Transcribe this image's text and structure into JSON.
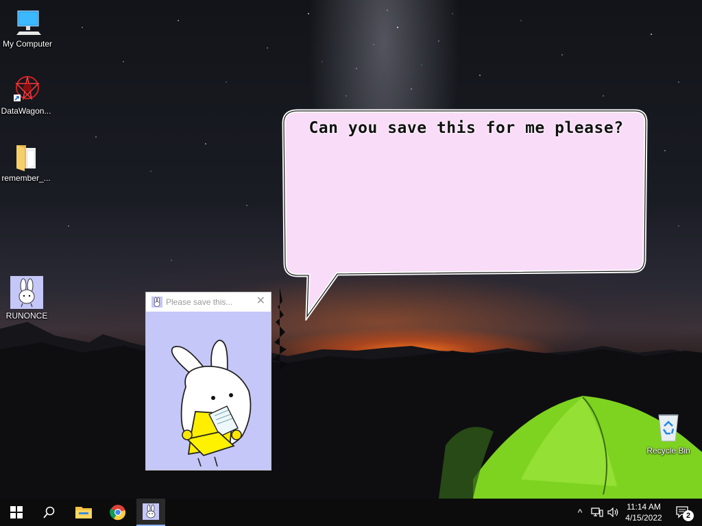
{
  "desktop": {
    "icons": [
      {
        "label": "My Computer",
        "icon": "computer-icon"
      },
      {
        "label": "DataWagon...",
        "icon": "datawagon-shortcut-icon"
      },
      {
        "label": "remember_...",
        "icon": "folder-icon"
      },
      {
        "label": "RUNONCE",
        "icon": "bunny-app-icon"
      },
      {
        "label": "Recycle Bin",
        "icon": "recycle-bin-icon"
      }
    ]
  },
  "bubble": {
    "text": "Can you save this for me please?",
    "fill_color": "#f9dcf7"
  },
  "window": {
    "title": "Please save this...",
    "close_glyph": "✕",
    "background": "#c5c7f8",
    "image": "bunny-holding-folder"
  },
  "taskbar": {
    "start_icon": "windows-start-icon",
    "search_icon": "search-icon",
    "pinned": [
      "file-explorer-icon",
      "chrome-icon",
      "bunny-app-icon"
    ],
    "tray": {
      "chevron": "^",
      "time": "11:14 AM",
      "date": "4/15/2022",
      "notification_count": "2"
    }
  }
}
